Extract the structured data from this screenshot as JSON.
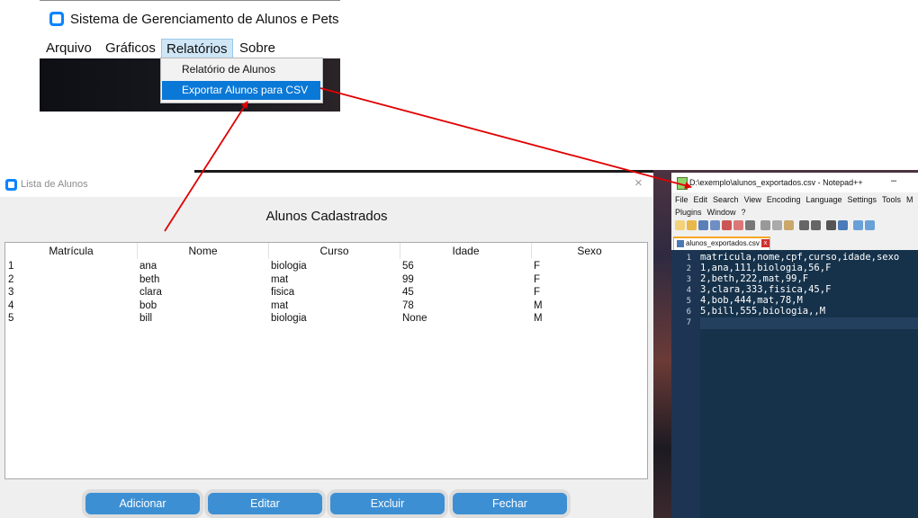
{
  "app": {
    "title": "Sistema de Gerenciamento de Alunos e Pets",
    "menu": [
      "Arquivo",
      "Gráficos",
      "Relatórios",
      "Sobre"
    ],
    "active_menu": "Relatórios",
    "dropdown": [
      {
        "label": "Relatório de Alunos",
        "selected": false
      },
      {
        "label": "Exportar Alunos para CSV",
        "selected": true
      }
    ]
  },
  "lista": {
    "window_title": "Lista de Alunos",
    "close_glyph": "×",
    "heading": "Alunos Cadastrados",
    "columns": [
      "Matrícula",
      "Nome",
      "Curso",
      "Idade",
      "Sexo"
    ],
    "rows": [
      [
        "1",
        "ana",
        "biologia",
        "56",
        "F"
      ],
      [
        "2",
        "beth",
        "mat",
        "99",
        "F"
      ],
      [
        "3",
        "clara",
        "fisica",
        "45",
        "F"
      ],
      [
        "4",
        "bob",
        "mat",
        "78",
        "M"
      ],
      [
        "5",
        "bill",
        "biologia",
        "None",
        "M"
      ]
    ],
    "buttons": {
      "add": "Adicionar",
      "edit": "Editar",
      "delete": "Excluir",
      "close": "Fechar"
    }
  },
  "notepad": {
    "title": "D:\\exemplo\\alunos_exportados.csv - Notepad++",
    "minimize_glyph": "–",
    "menu_row1": [
      "File",
      "Edit",
      "Search",
      "View",
      "Encoding",
      "Language",
      "Settings",
      "Tools",
      "M"
    ],
    "menu_row2": [
      "Plugins",
      "Window",
      "?"
    ],
    "tab": "alunos_exportados.csv",
    "tab_close": "x",
    "lines": [
      "matricula,nome,cpf,curso,idade,sexo",
      "1,ana,111,biologia,56,F",
      "2,beth,222,mat,99,F",
      "3,clara,333,fisica,45,F",
      "4,bob,444,mat,78,M",
      "5,bill,555,biologia,,M",
      ""
    ],
    "line_numbers": [
      "1",
      "2",
      "3",
      "4",
      "5",
      "6",
      "7"
    ]
  },
  "colors": {
    "accent": "#0a78d7",
    "button": "#3d8fd3",
    "arrow": "#e00000",
    "editor_bg": "#16324b"
  }
}
